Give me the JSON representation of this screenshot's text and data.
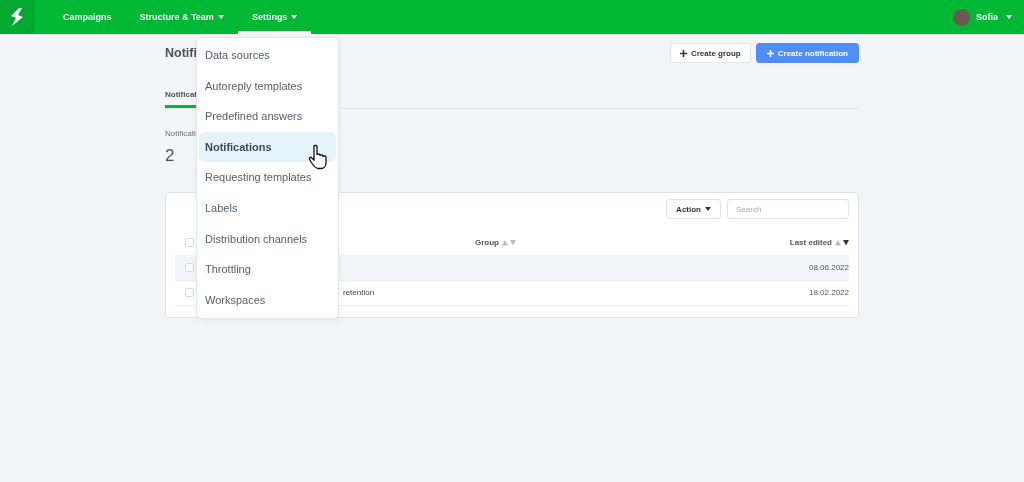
{
  "navbar": {
    "items": [
      {
        "label": "Campaigns",
        "selected": false,
        "dropdown": false
      },
      {
        "label": "Structure & Team",
        "selected": false,
        "dropdown": true
      },
      {
        "label": "Settings",
        "selected": true,
        "dropdown": true
      }
    ],
    "user": {
      "name": "Sofia"
    }
  },
  "page": {
    "title": "Notifi",
    "actions": [
      {
        "label": "Create group",
        "kind": "secondary"
      },
      {
        "label": "Create notification",
        "kind": "primary"
      }
    ],
    "tabs": [
      {
        "label": "Notificat",
        "selected": true
      }
    ],
    "stat": {
      "label": "Notificati",
      "value": "2"
    }
  },
  "table": {
    "action_button": "Action",
    "search": {
      "placeholder": "Search"
    },
    "header_checked": false,
    "columns": [
      {
        "label": "Group",
        "sorted": false
      },
      {
        "label": "Last edited",
        "sorted": true
      }
    ],
    "rows": [
      {
        "checked": false,
        "hovered": true,
        "last_edited": "08.06.2022"
      },
      {
        "checked": false,
        "hovered": false,
        "name": "retention",
        "last_edited": "18.02.2022"
      }
    ]
  },
  "settings_menu": {
    "items": [
      {
        "label": "Data sources",
        "selected": false
      },
      {
        "label": "Autoreply templates",
        "selected": false
      },
      {
        "label": "Predefined answers",
        "selected": false
      },
      {
        "label": "Notifications",
        "selected": true
      },
      {
        "label": "Requesting templates",
        "selected": false
      },
      {
        "label": "Labels",
        "selected": false
      },
      {
        "label": "Distribution channels",
        "selected": false
      },
      {
        "label": "Throttling",
        "selected": false
      },
      {
        "label": "Workspaces",
        "selected": false
      }
    ]
  }
}
